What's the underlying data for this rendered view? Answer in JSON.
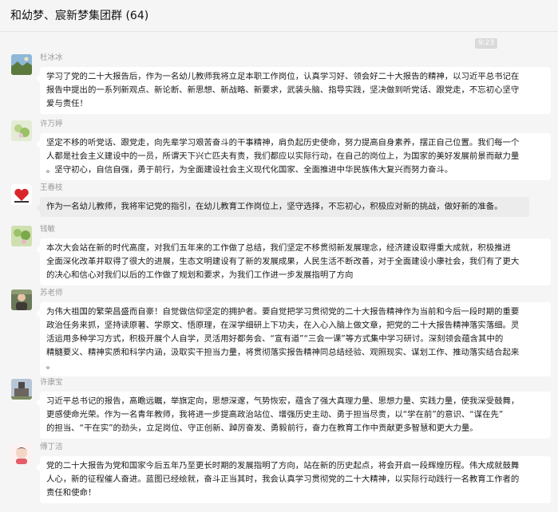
{
  "header": {
    "title": "和幼梦、宸新梦集团群 (64)"
  },
  "time_badge": "9:23",
  "messages": [
    {
      "sender": "杜冰冰",
      "avatar_icon": "landscape-photo-avatar",
      "text": "学习了党的二十大报告后，作为一名幼儿教师我将立足本职工作岗位，认真学习好、领会好二十大报告的精神，以习近平总书记在\n报告中提出的一系列新观点、新论断、新思想、新战略、新要求，武装头脑、指导实践，坚决做到听党话、跟党走，不忘初心坚守\n爱与责任！"
    },
    {
      "sender": "许万婷",
      "avatar_icon": "flower-photo-avatar",
      "text": "坚定不移的听党话、跟党走，向先辈学习艰苦奋斗的干事精神，肩负起历史使命，努力提高自身素养，摆正自己位置。我们每一个\n人都是社会主义建设中的一员，所谓天下兴亡匹夫有责，我们都应以实际行动，在自己的岗位上，为国家的美好发展前景而献力量\n。坚守初心，自信自强，勇于前行，为全面建设社会主义现代化国家、全面推进中华民族伟大复兴而努力奋斗。"
    },
    {
      "sender": "王春枝",
      "avatar_icon": "heart-graphic-avatar",
      "text": "作为一名幼儿教师，我将牢记党的指引，在幼儿教育工作岗位上，坚守选择，不忘初心，积极应对新的挑战，做好新的准备。",
      "bubble_style": "gray"
    },
    {
      "sender": "钱敏",
      "avatar_icon": "garden-photo-avatar",
      "text": "    本次大会站在新的时代高度，对我们五年来的工作做了总结，我们坚定不移贯彻新发展理念，经济建设取得重大成就，积极推进\n全面深化改革并取得了很大的进展，生态文明建设有了新的发展成果，人民生活不断改善，对于全面建设小康社会，我们有了更大\n的决心和信心对我们以后的工作做了规划和要求，为我们工作进一步发展指明了方向"
    },
    {
      "sender": "苏老师",
      "avatar_icon": "portrait-photo-avatar",
      "text": "为伟大祖国的繁荣昌盛而自豪！自觉做信仰坚定的拥护者。要自觉把学习贯彻党的二十大报告精神作为当前和今后一段时期的重要\n政治任务来抓，坚持读原著、学原文、悟原理，在深学细研上下功夫，在入心入脑上做文章，把党的二十大报告精神落实落细。灵\n活运用多种学习方式，积极开展个人自学，灵活用好都务会、“宣有道”“三会一课”等方式集中学习研讨。深刻领会蕴含其中的\n精髓要义、精神实质和科学内涵，汲取实干担当力量，将贯彻落实报告精神同总结经验、观照现实、谋划工作、推动落实结合起来\n。"
    },
    {
      "sender": "许康宝",
      "avatar_icon": "building-photo-avatar",
      "text": "习近平总书记的报告，高瞻远瞩，举旗定向，思想深邃，气势恢宏，蕴含了强大真理力量、思想力量、实践力量，使我深受鼓舞，\n更感使命光荣。作为一名青年教师，我将进一步提高政治站位、增强历史主动、勇于担当尽责，以“学在前”的意识、“谋在先”\n的担当、“干在实”的劲头，立足岗位、守正创新、踔厉奋发、勇毅前行，奋力在教育工作中贡献更多智慧和更大力量。"
    },
    {
      "sender": "傅丁洁",
      "avatar_icon": "cartoon-avatar",
      "text": "党的二十大报告为党和国家今后五年乃至更长时期的发展指明了方向，站在新的历史起点，将会开启一段辉煌历程。伟大成就鼓舞\n人心，新的征程催人奋进。蓝图已经绘就，奋斗正当其时，我会认真学习贯彻党的二十大精神，以实际行动践行一名教育工作者的\n责任和使命！"
    }
  ],
  "colors": {
    "background": "#f5f5f5",
    "bubble": "#ffffff",
    "bubble_gray": "#ececec",
    "sender_text": "#9a9a9a",
    "time_badge": "#dadada"
  }
}
